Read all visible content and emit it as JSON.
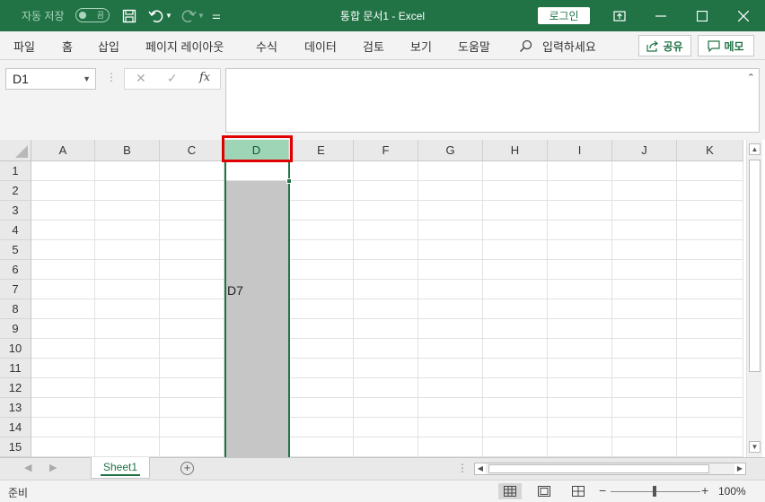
{
  "titlebar": {
    "autosave_label": "자동 저장",
    "autosave_toggle": "끔",
    "title": "통합 문서1  -  Excel",
    "login_label": "로그인"
  },
  "ribbon": {
    "tabs": [
      "파일",
      "홈",
      "삽입",
      "페이지 레이아웃",
      "수식",
      "데이터",
      "검토",
      "보기",
      "도움말"
    ],
    "search_placeholder": "입력하세요",
    "share_label": "공유",
    "memo_label": "메모"
  },
  "formula_bar": {
    "name_box": "D1",
    "fx_label": "fx",
    "value": ""
  },
  "grid": {
    "columns": [
      "A",
      "B",
      "C",
      "D",
      "E",
      "F",
      "G",
      "H",
      "I",
      "J",
      "K"
    ],
    "rows": [
      "1",
      "2",
      "3",
      "4",
      "5",
      "6",
      "7",
      "8",
      "9",
      "10",
      "11",
      "12",
      "13",
      "14",
      "15"
    ],
    "selected_column": "D",
    "cell_d7": "D7"
  },
  "sheets": {
    "tabs": [
      "Sheet1"
    ],
    "active": "Sheet1"
  },
  "status": {
    "ready_text": "준비",
    "zoom_level": "100%"
  },
  "colors": {
    "accent": "#217346",
    "highlight": "#e00000"
  }
}
